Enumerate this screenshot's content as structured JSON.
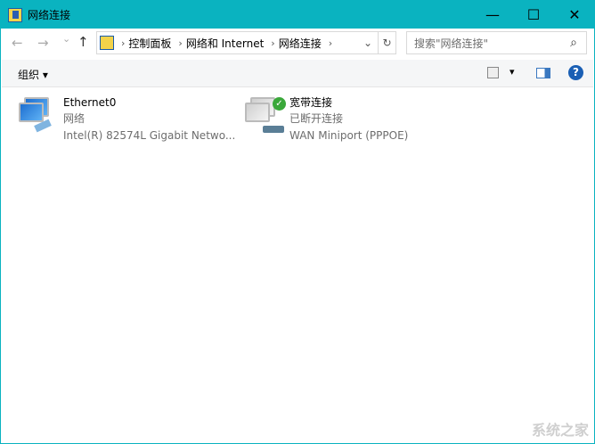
{
  "window": {
    "title": "网络连接"
  },
  "controls": {
    "minimize": "—",
    "maximize": "☐",
    "close": "✕"
  },
  "nav": {
    "back": "←",
    "forward": "→",
    "recent": "⌄",
    "up": "↑"
  },
  "breadcrumb": [
    "控制面板",
    "网络和 Internet",
    "网络连接"
  ],
  "address": {
    "dropdown": "⌄",
    "refresh": "↻",
    "separator": "›"
  },
  "search": {
    "placeholder": "搜索\"网络连接\"",
    "icon": "⌕"
  },
  "toolbar": {
    "organize": "组织 ▾",
    "view": "▾",
    "help": "?"
  },
  "connections": [
    {
      "name": "Ethernet0",
      "status": "网络",
      "device": "Intel(R) 82574L Gigabit Netwo..."
    },
    {
      "name": "宽带连接",
      "status": "已断开连接",
      "device": "WAN Miniport (PPPOE)"
    }
  ],
  "watermark": "系统之家"
}
